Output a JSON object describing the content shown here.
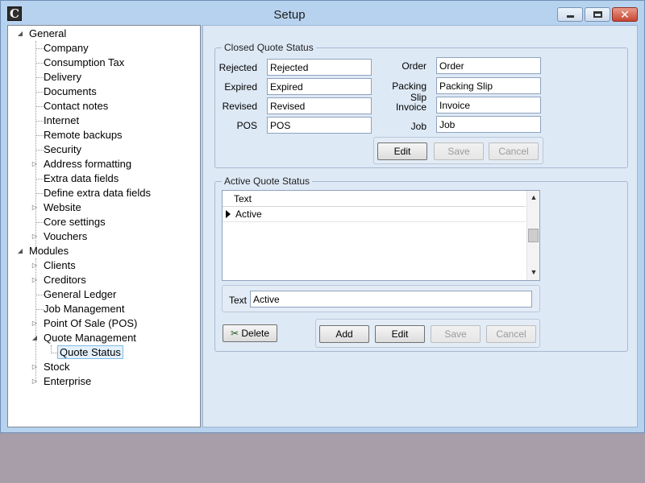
{
  "window": {
    "title": "Setup",
    "app_icon_letter": "C"
  },
  "tree": {
    "general": {
      "label": "General",
      "children": [
        "Company",
        "Consumption Tax",
        "Delivery",
        "Documents",
        "Contact notes",
        "Internet",
        "Remote backups",
        "Security",
        "Address formatting",
        "Extra data fields",
        "Define extra data fields",
        "Website",
        "Core settings",
        "Vouchers"
      ]
    },
    "modules": {
      "label": "Modules",
      "children": [
        "Clients",
        "Creditors",
        "General Ledger",
        "Job Management",
        "Point Of Sale (POS)",
        "Quote Management",
        "Quote Status",
        "Stock",
        "Enterprise"
      ]
    },
    "selected": "Quote Status"
  },
  "closed_status": {
    "legend": "Closed Quote Status",
    "labels": {
      "rejected": "Rejected",
      "expired": "Expired",
      "revised": "Revised",
      "pos": "POS",
      "order": "Order",
      "packing_slip": "Packing Slip",
      "invoice": "Invoice",
      "job": "Job"
    },
    "values": {
      "rejected": "Rejected",
      "expired": "Expired",
      "revised": "Revised",
      "pos": "POS",
      "order": "Order",
      "packing_slip": "Packing Slip",
      "invoice": "Invoice",
      "job": "Job"
    },
    "buttons": {
      "edit": "Edit",
      "save": "Save",
      "cancel": "Cancel"
    }
  },
  "active_status": {
    "legend": "Active Quote Status",
    "grid": {
      "header": "Text",
      "rows": [
        "Active"
      ]
    },
    "text_label": "Text",
    "text_value": "Active",
    "buttons": {
      "delete": "Delete",
      "add": "Add",
      "edit": "Edit",
      "save": "Save",
      "cancel": "Cancel"
    }
  }
}
